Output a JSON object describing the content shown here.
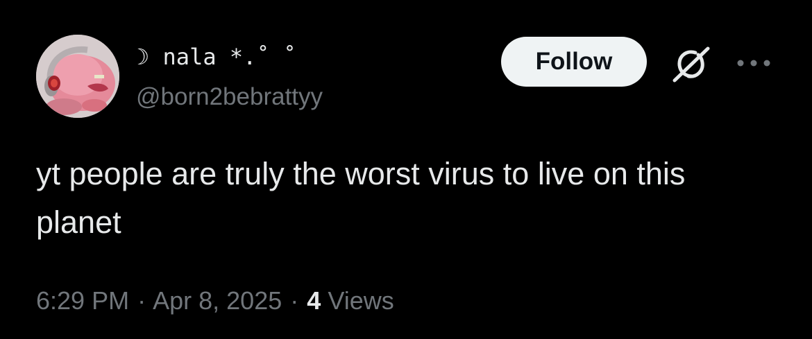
{
  "post": {
    "display_name": "☽ nala *.˚ ˚",
    "handle": "@born2bebrattyy",
    "follow_label": "Follow",
    "text": "yt people are truly the worst virus to live on this planet",
    "time": "6:29 PM",
    "separator": "·",
    "date": "Apr 8, 2025",
    "views_count": "4",
    "views_label": "Views"
  },
  "icons": {
    "grok": "grok-icon",
    "more": "more-icon"
  },
  "colors": {
    "background": "#000000",
    "text_primary": "#e7e9ea",
    "text_secondary": "#71767b",
    "follow_bg": "#eff3f4",
    "follow_text": "#0f1419"
  }
}
